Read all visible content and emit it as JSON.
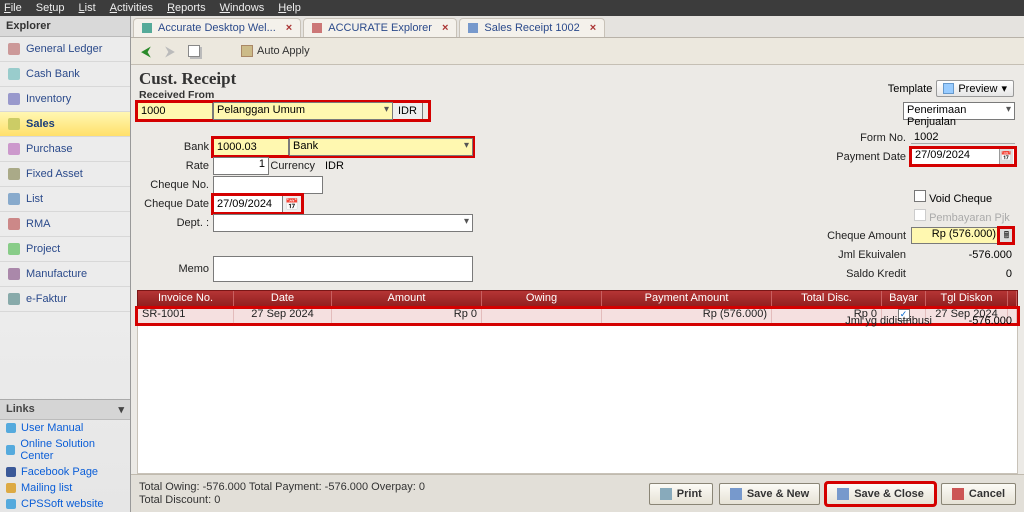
{
  "menubar": [
    "File",
    "Setup",
    "List",
    "Activities",
    "Reports",
    "Windows",
    "Help"
  ],
  "sidebar": {
    "title": "Explorer",
    "items": [
      {
        "label": "General Ledger"
      },
      {
        "label": "Cash Bank"
      },
      {
        "label": "Inventory"
      },
      {
        "label": "Sales"
      },
      {
        "label": "Purchase"
      },
      {
        "label": "Fixed Asset"
      },
      {
        "label": "List"
      },
      {
        "label": "RMA"
      },
      {
        "label": "Project"
      },
      {
        "label": "Manufacture"
      },
      {
        "label": "e-Faktur"
      }
    ],
    "links_title": "Links",
    "links": [
      {
        "label": "User Manual"
      },
      {
        "label": "Online Solution Center"
      },
      {
        "label": "Facebook Page"
      },
      {
        "label": "Mailing list"
      },
      {
        "label": "CPSSoft website"
      }
    ]
  },
  "tabs": [
    {
      "label": "Accurate Desktop Wel..."
    },
    {
      "label": "ACCURATE Explorer"
    },
    {
      "label": "Sales Receipt 1002"
    }
  ],
  "toolbar": {
    "auto_apply": "Auto Apply"
  },
  "form": {
    "heading": "Cust. Receipt",
    "received_from": "Received From",
    "cust_code": "1000",
    "cust_name": "Pelanggan Umum",
    "currency_badge": "IDR",
    "template_label": "Template",
    "preview": "Preview",
    "template_value": "Penerimaan Penjualan",
    "form_no_label": "Form No.",
    "form_no": "1002",
    "payment_date_label": "Payment Date",
    "payment_date": "27/09/2024",
    "bank_label": "Bank",
    "bank_code": "1000.03",
    "bank_name": "Bank",
    "rate_label": "Rate",
    "rate": "1",
    "currency_label": "Currency",
    "currency": "IDR",
    "cheque_no_label": "Cheque No.",
    "cheque_date_label": "Cheque Date",
    "cheque_date": "27/09/2024",
    "dept_label": "Dept. :",
    "memo_label": "Memo",
    "void_cheque": "Void Cheque",
    "pembayaran_pjk": "Pembayaran Pjk",
    "cheque_amount_label": "Cheque Amount",
    "cheque_amount": "Rp (576.000)",
    "jml_ekuiv_label": "Jml Ekuivalen",
    "jml_ekuiv": "-576.000",
    "saldo_label": "Saldo Kredit",
    "saldo": "0",
    "jml_dist_label": "Jml yg didistribusi",
    "jml_dist": "-576.000"
  },
  "grid": {
    "cols": [
      "Invoice No.",
      "Date",
      "Amount",
      "Owing",
      "Payment Amount",
      "Total Disc.",
      "Bayar",
      "Tgl Diskon"
    ],
    "row": {
      "inv": "SR-1001",
      "date": "27 Sep 2024",
      "amount": "Rp 0",
      "owing": "",
      "payment": "Rp (576.000)",
      "disc": "Rp 0",
      "bayar": "✓",
      "tgldiskon": "27 Sep 2024"
    }
  },
  "footer": {
    "totals_line1": "Total Owing: -576.000   Total Payment: -576.000   Overpay: 0",
    "totals_line2": "Total Discount: 0",
    "print": "Print",
    "save_new": "Save & New",
    "save_close": "Save & Close",
    "cancel": "Cancel"
  }
}
